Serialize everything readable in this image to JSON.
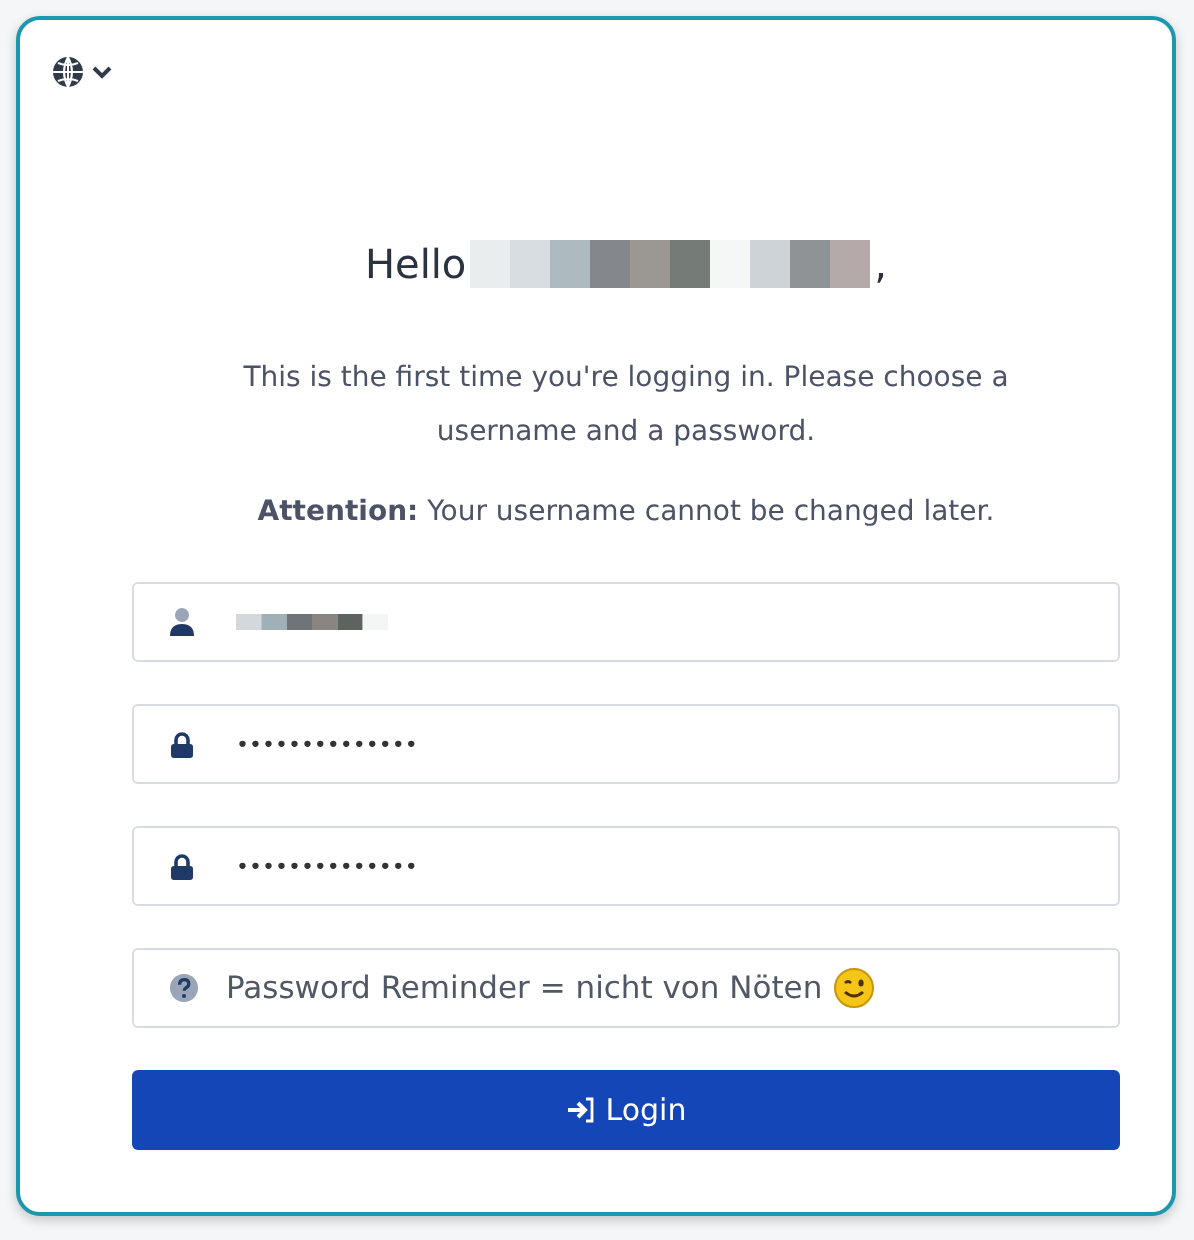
{
  "language_menu": {
    "expanded": false
  },
  "greeting": {
    "prefix": "Hello",
    "suffix": ","
  },
  "intro": "This is the first time you're logging in. Please choose a username and a password.",
  "attention": "**Attention:** Your username cannot be changed later.",
  "fields": [
    {
      "kind": "username"
    },
    {
      "kind": "password",
      "value": "••••••••••••••"
    },
    {
      "kind": "password",
      "value": "••••••••••••••"
    },
    {
      "kind": "reminder",
      "value": "Password Reminder = nicht von Nöten"
    }
  ],
  "login_button": {
    "label": "Login"
  }
}
